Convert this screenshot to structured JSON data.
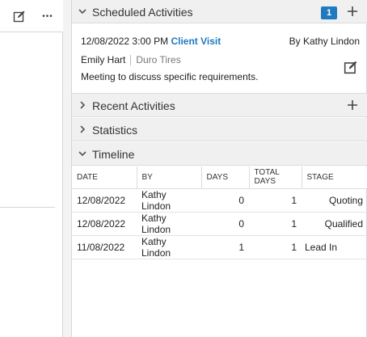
{
  "left_toolbar": {
    "edit_icon": "edit-icon",
    "more_icon": "more-icon",
    "more_label": "•••"
  },
  "scheduled": {
    "title": "Scheduled Activities",
    "count": "1",
    "activity": {
      "date_time": "12/08/2022 3:00 PM",
      "type": "Client Visit",
      "by_label": "By",
      "by_name": "Kathy Lindon",
      "contact": "Emily Hart",
      "company": "Duro Tires",
      "description": "Meeting to discuss specific requirements."
    }
  },
  "recent": {
    "title": "Recent Activities"
  },
  "statistics": {
    "title": "Statistics"
  },
  "timeline": {
    "title": "Timeline",
    "columns": [
      "DATE",
      "BY",
      "DAYS",
      "TOTAL DAYS",
      "STAGE"
    ],
    "rows": [
      {
        "date": "12/08/2022",
        "by": "Kathy Lindon",
        "days": "0",
        "total_days": "1",
        "stage": "Quoting"
      },
      {
        "date": "12/08/2022",
        "by": "Kathy Lindon",
        "days": "0",
        "total_days": "1",
        "stage": "Qualified"
      },
      {
        "date": "11/08/2022",
        "by": "Kathy Lindon",
        "days": "1",
        "total_days": "1",
        "stage": "Lead In"
      }
    ]
  },
  "colors": {
    "accent": "#1f7abf",
    "header_bg": "#f0f0f0"
  }
}
